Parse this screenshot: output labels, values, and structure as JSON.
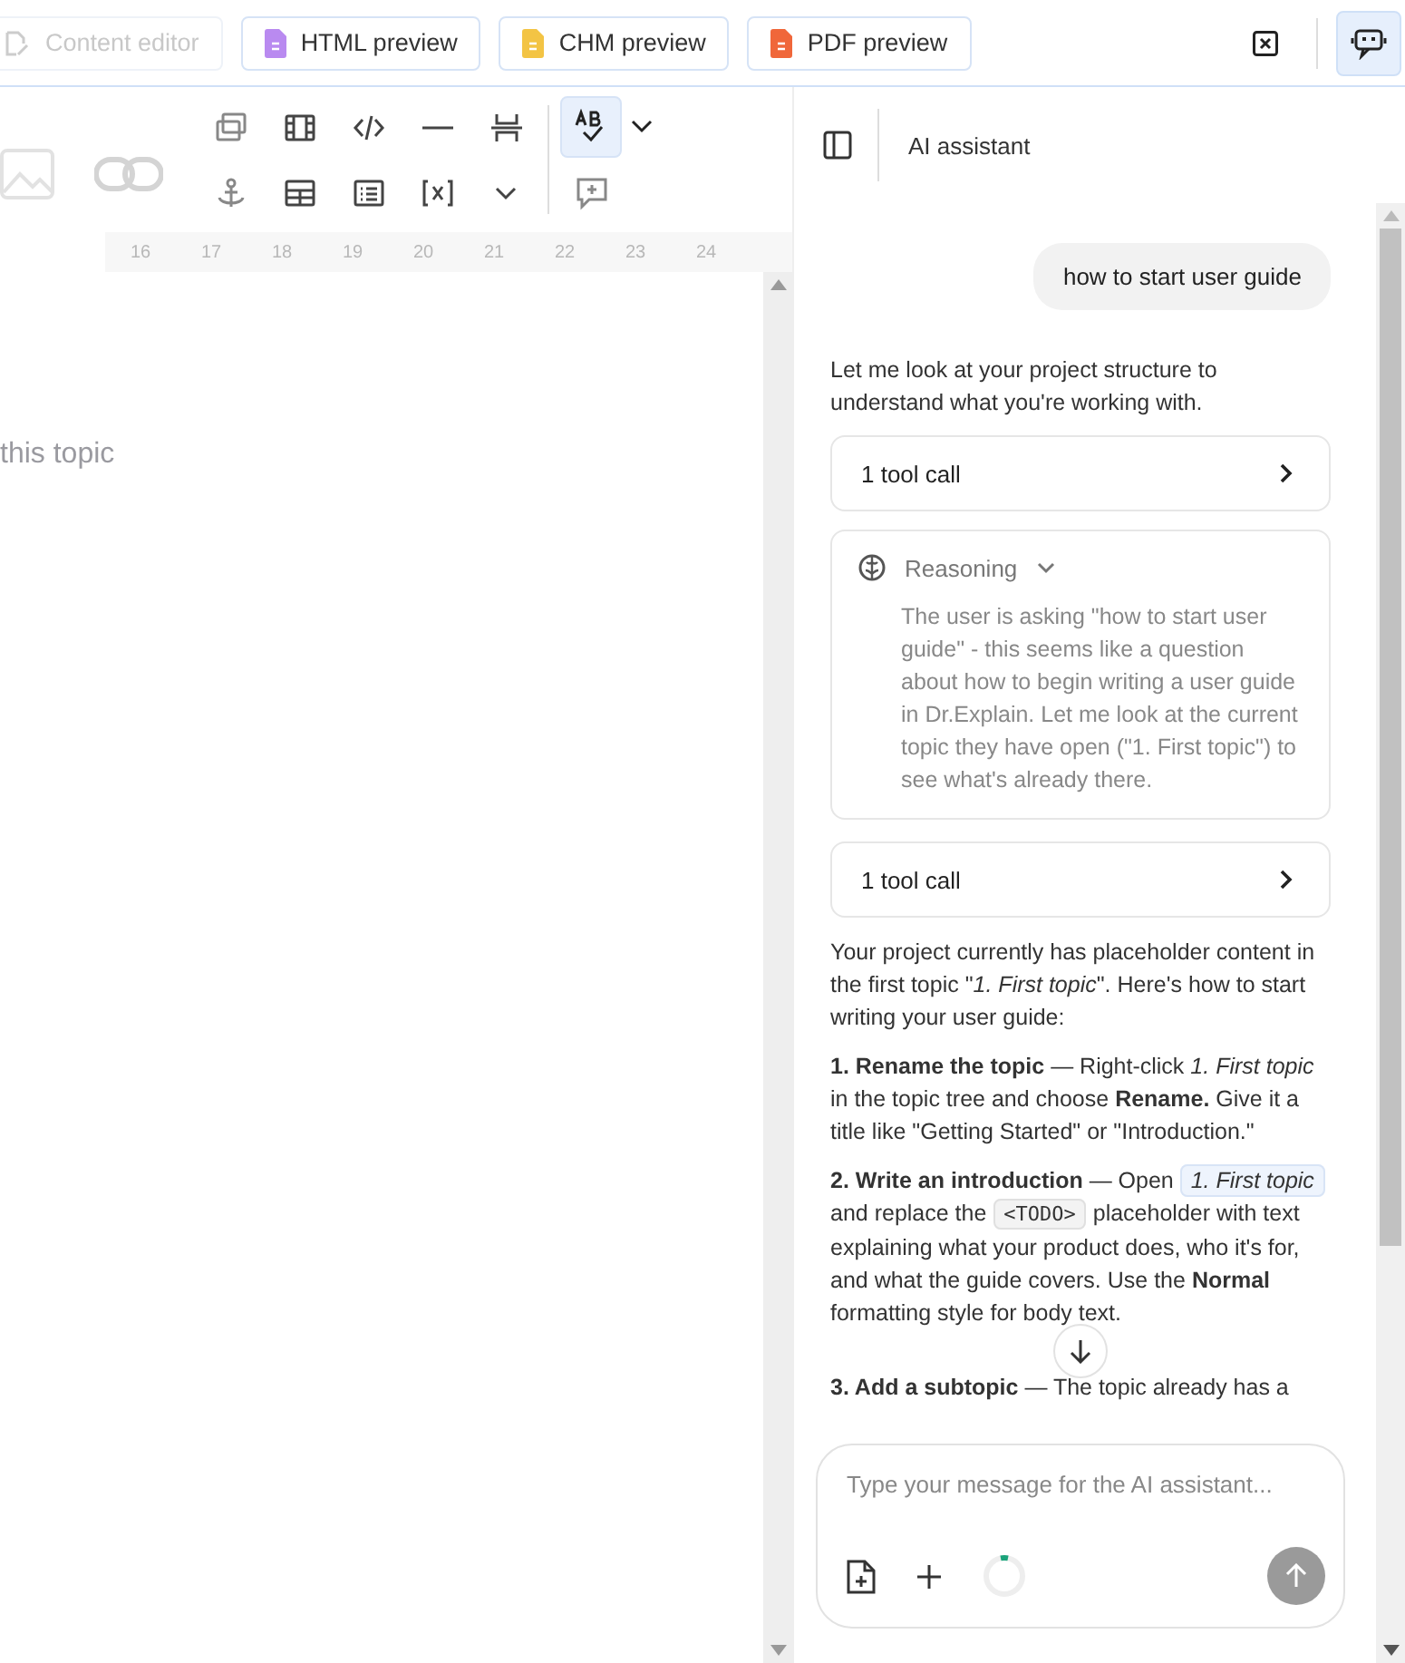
{
  "tabs": [
    {
      "label": "Content editor",
      "kind": "editor",
      "disabled": true
    },
    {
      "label": "HTML preview",
      "kind": "html",
      "disabled": false
    },
    {
      "label": "CHM preview",
      "kind": "chm",
      "disabled": false
    },
    {
      "label": "PDF preview",
      "kind": "pdf",
      "disabled": false
    }
  ],
  "ai_toggle": {
    "on": true
  },
  "toolbar": {
    "spellcheck": {
      "on": true
    }
  },
  "ruler": [
    "16",
    "17",
    "18",
    "19",
    "20",
    "21",
    "22",
    "23",
    "24"
  ],
  "editor": {
    "text": "this topic"
  },
  "chat": {
    "title": "AI assistant",
    "messages": [
      {
        "kind": "user",
        "text": "how to start user guide"
      },
      {
        "kind": "text",
        "paragraphs": [
          [
            {
              "kind": "text",
              "text": "Let me look at your project structure to understand what you're working with."
            }
          ]
        ]
      },
      {
        "kind": "tool_call",
        "label": "1 tool call",
        "expanded": false
      },
      {
        "kind": "reasoning",
        "label": "Reasoning",
        "expanded": true,
        "text": "The user is asking \"how to start user guide\" - this seems like a question about how to begin writing a user guide in Dr.Explain. Let me look at the current topic they have open (\"1. First topic\") to see what's already there."
      },
      {
        "kind": "tool_call",
        "label": "1 tool call",
        "expanded": false
      },
      {
        "kind": "text",
        "paragraphs": [
          [
            {
              "kind": "text",
              "text": "Your project currently has placeholder content in the first topic \"*1. First topic*\". Here's how to start writing your user guide:"
            }
          ],
          [
            {
              "kind": "text",
              "text": "**1. Rename the topic** — Right-click *1. First topic* in the topic tree and choose **Rename.** Give it a title like \"Getting Started\" or \"Introduction.\""
            }
          ],
          [
            {
              "kind": "text",
              "text": "**2. Write an introduction** — Open "
            },
            {
              "kind": "topic",
              "text": "1. First topic"
            },
            {
              "kind": "text",
              "text": " and replace the "
            },
            {
              "kind": "code",
              "text": "<TODO>"
            },
            {
              "kind": "text",
              "text": " placeholder with text explaining what your product does, who it's for, and what the guide covers. Use the **Normal** formatting style for body text."
            }
          ],
          [
            {
              "kind": "text",
              "text": "**3. Add a subtopic** — The topic already has a"
            }
          ]
        ]
      }
    ],
    "composer": {
      "placeholder": "Type your message for the AI assistant...",
      "busy": true,
      "send_enabled": false
    }
  }
}
